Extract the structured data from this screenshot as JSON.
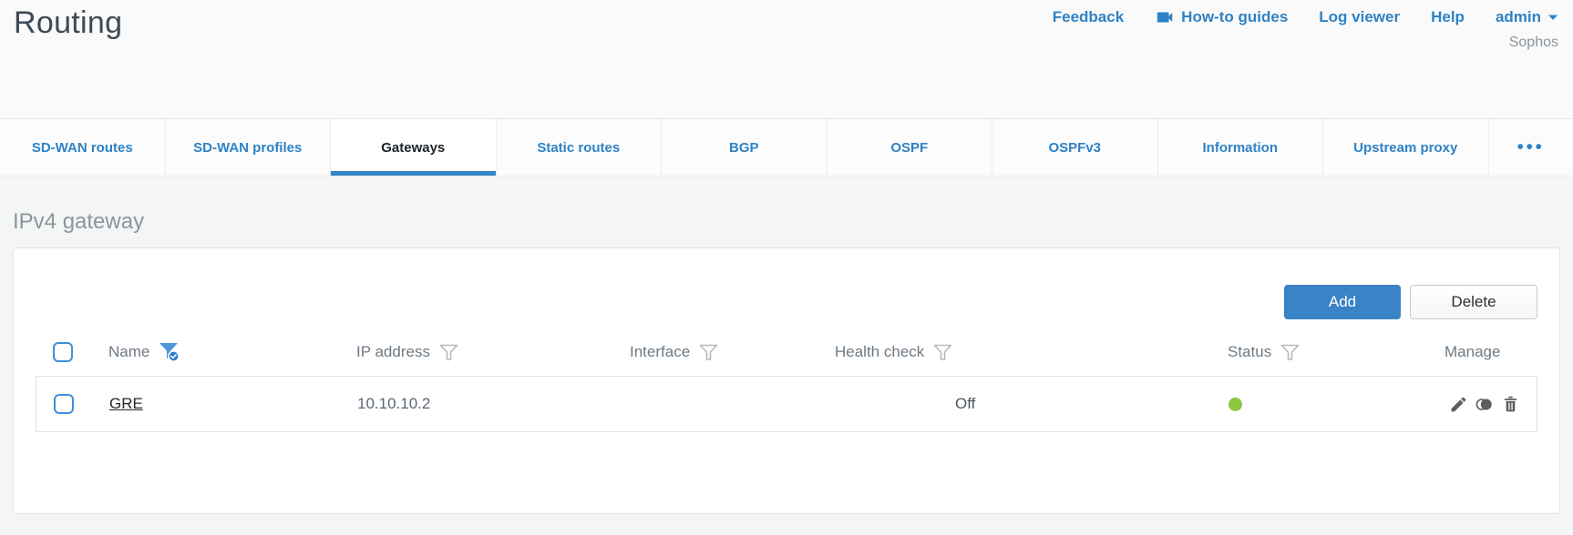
{
  "page": {
    "title": "Routing",
    "brand": "Sophos"
  },
  "header": {
    "links": {
      "feedback": "Feedback",
      "howto": "How-to guides",
      "log_viewer": "Log viewer",
      "help": "Help",
      "admin": "admin"
    }
  },
  "tabs": {
    "items": [
      {
        "label": "SD-WAN routes"
      },
      {
        "label": "SD-WAN profiles"
      },
      {
        "label": "Gateways"
      },
      {
        "label": "Static routes"
      },
      {
        "label": "BGP"
      },
      {
        "label": "OSPF"
      },
      {
        "label": "OSPFv3"
      },
      {
        "label": "Information"
      },
      {
        "label": "Upstream proxy"
      }
    ],
    "active": "Gateways",
    "more_label": "•••"
  },
  "section": {
    "heading": "IPv4 gateway"
  },
  "toolbar": {
    "add_label": "Add",
    "delete_label": "Delete"
  },
  "table": {
    "columns": [
      {
        "label": "Name",
        "filter": "active"
      },
      {
        "label": "IP address",
        "filter": "inactive"
      },
      {
        "label": "Interface",
        "filter": "inactive"
      },
      {
        "label": "Health check",
        "filter": "inactive"
      },
      {
        "label": "Status",
        "filter": "inactive"
      },
      {
        "label": "Manage",
        "filter": "none"
      }
    ],
    "rows": [
      {
        "name": "GRE",
        "ip_address": "10.10.10.2",
        "interface": "",
        "health_check": "Off",
        "status": "up"
      }
    ]
  },
  "colors": {
    "accent_blue": "#3385c7",
    "button_blue": "#3a83c6",
    "status_up_green": "#8dc63f",
    "title_text": "#3e4a56",
    "heading_gray": "#8b959e"
  }
}
